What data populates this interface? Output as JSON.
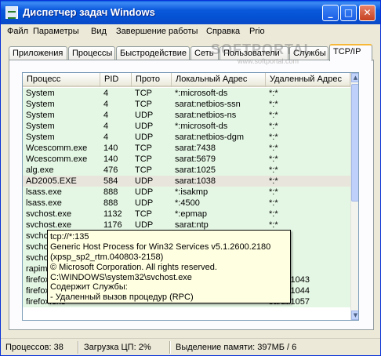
{
  "window": {
    "title": "Диспетчер задач Windows",
    "controls": {
      "minimize": "_",
      "maximize": "□",
      "close": "✕"
    }
  },
  "menu": [
    "Файл",
    "Параметры",
    "Вид",
    "Завершение работы",
    "Справка",
    "Prio"
  ],
  "tabs": [
    "Приложения",
    "Процессы",
    "Быстродействие",
    "Сеть",
    "Пользователи",
    "Службы",
    "TCP/IP"
  ],
  "active_tab": "TCP/IP",
  "watermark": {
    "brand": "SOFTPORTAL",
    "site": "www.softportal.com"
  },
  "table": {
    "columns": [
      "Процесс",
      "PID",
      "Прото",
      "Локальный Адрес",
      "Удаленный Адрес"
    ],
    "rows": [
      [
        "System",
        "4",
        "TCP",
        "*:microsoft-ds",
        "*:*"
      ],
      [
        "System",
        "4",
        "TCP",
        "sarat:netbios-ssn",
        "*:*"
      ],
      [
        "System",
        "4",
        "UDP",
        "sarat:netbios-ns",
        "*:*"
      ],
      [
        "System",
        "4",
        "UDP",
        "*:microsoft-ds",
        "*:*"
      ],
      [
        "System",
        "4",
        "UDP",
        "sarat:netbios-dgm",
        "*:*"
      ],
      [
        "Wcescomm.exe",
        "140",
        "TCP",
        "sarat:7438",
        "*:*"
      ],
      [
        "Wcescomm.exe",
        "140",
        "TCP",
        "sarat:5679",
        "*:*"
      ],
      [
        "alg.exe",
        "476",
        "TCP",
        "sarat:1025",
        "*:*"
      ],
      [
        "AD2005.EXE",
        "584",
        "UDP",
        "sarat:1038",
        "*:*"
      ],
      [
        "lsass.exe",
        "888",
        "UDP",
        "*:isakmp",
        "*:*"
      ],
      [
        "lsass.exe",
        "888",
        "UDP",
        "*:4500",
        "*:*"
      ],
      [
        "svchost.exe",
        "1132",
        "TCP",
        "*:epmap",
        "*:*"
      ],
      [
        "svchost.exe",
        "1176",
        "UDP",
        "sarat:ntp",
        "*:*"
      ],
      [
        "svchost.exe",
        "",
        "",
        "",
        "*:*"
      ],
      [
        "svchost.exe",
        "",
        "",
        "",
        "*:*"
      ],
      [
        "svchost.exe",
        "",
        "",
        "",
        "*:*"
      ],
      [
        "rapimgr.exe",
        "",
        "",
        "",
        "*:*"
      ],
      [
        "firefox.exe",
        "",
        "",
        "",
        "sarat:1043"
      ],
      [
        "firefox.exe",
        "",
        "",
        "",
        "sarat:1044"
      ],
      [
        "firefox.exe",
        "",
        "",
        "",
        "sarat:1057"
      ]
    ],
    "selected_row": "AD2005.EXE"
  },
  "tooltip": [
    "tcp://*:135",
    "Generic Host Process for Win32 Services v5.1.2600.2180",
    "(xpsp_sp2_rtm.040803-2158)",
    "© Microsoft Corporation. All rights reserved.",
    "C:\\WINDOWS\\system32\\svchost.exe",
    "Содержит Службы:",
    " - Удаленный вызов процедур (RPC)"
  ],
  "status": {
    "processes": "Процессов: 38",
    "cpu": "Загрузка ЦП: 2%",
    "memory": "Выделение памяти: 397МБ / 6"
  },
  "colors": {
    "titlebar": "#0a58db",
    "row_highlight": "#e4f7e4",
    "selected_row": "#e8e6dc",
    "tooltip_bg": "#ffffe1",
    "active_tab_accent": "#f6b836"
  }
}
